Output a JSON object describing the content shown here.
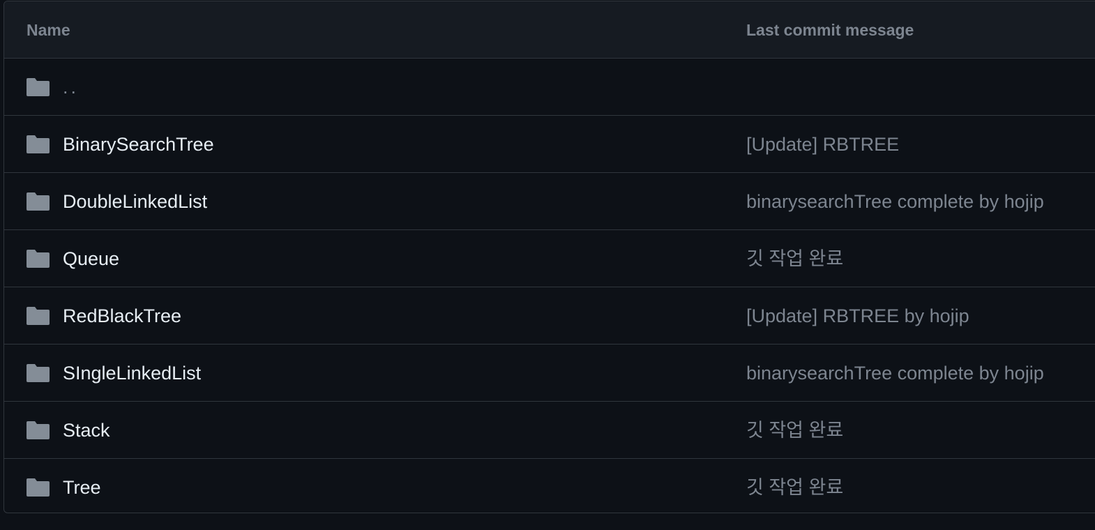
{
  "header": {
    "name_label": "Name",
    "commit_label": "Last commit message"
  },
  "rows": [
    {
      "name": "..",
      "commit": "",
      "icon": "folder-icon"
    },
    {
      "name": "BinarySearchTree",
      "commit": "[Update] RBTREE",
      "icon": "folder-icon"
    },
    {
      "name": "DoubleLinkedList",
      "commit": "binarysearchTree complete by hojip",
      "icon": "folder-icon"
    },
    {
      "name": "Queue",
      "commit": "깃 작업 완료",
      "icon": "folder-icon"
    },
    {
      "name": "RedBlackTree",
      "commit": "[Update] RBTREE by hojip",
      "icon": "folder-icon"
    },
    {
      "name": "SIngleLinkedList",
      "commit": "binarysearchTree complete by hojip",
      "icon": "folder-icon"
    },
    {
      "name": "Stack",
      "commit": "깃 작업 완료",
      "icon": "folder-icon"
    },
    {
      "name": "Tree",
      "commit": "깃 작업 완료",
      "icon": "folder-icon"
    }
  ],
  "colors": {
    "background": "#0d1117",
    "header_background": "#161b22",
    "border": "#30363d",
    "primary_text": "#e6edf3",
    "muted_text": "#7d8590",
    "folder_icon": "#848d97"
  }
}
